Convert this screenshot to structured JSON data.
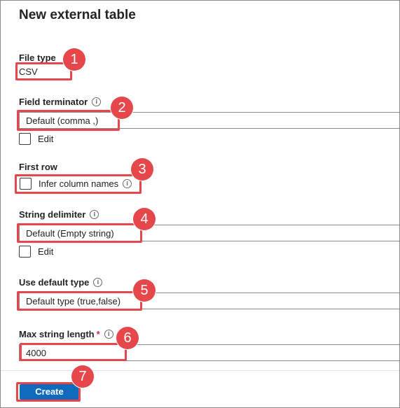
{
  "panel": {
    "title": "New external table"
  },
  "file_type": {
    "label": "File type",
    "value": "CSV"
  },
  "field_terminator": {
    "label": "Field terminator",
    "value": "Default (comma ,)",
    "edit_label": "Edit"
  },
  "first_row": {
    "label": "First row",
    "infer_label": "Infer column names"
  },
  "string_delimiter": {
    "label": "String delimiter",
    "value": "Default (Empty string)",
    "edit_label": "Edit"
  },
  "default_type": {
    "label": "Use default type",
    "value": "Default type (true,false)"
  },
  "max_string_length": {
    "label": "Max string length",
    "required_mark": "*",
    "value": "4000"
  },
  "actions": {
    "create_label": "Create"
  },
  "annotations": [
    "1",
    "2",
    "3",
    "4",
    "5",
    "6",
    "7"
  ],
  "colors": {
    "highlight": "#e5474b",
    "primary_button": "#0f6cbd"
  },
  "icons": {
    "info": "info-circle-icon"
  }
}
